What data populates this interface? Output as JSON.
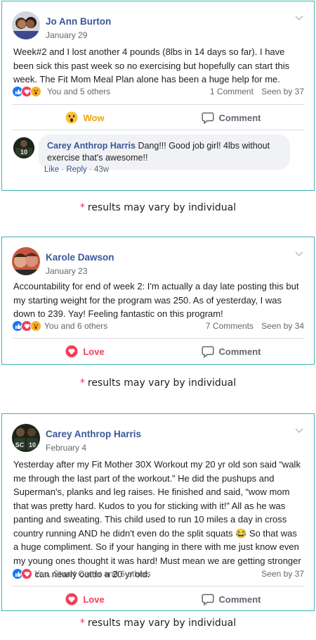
{
  "posts": [
    {
      "author": "Jo Ann Burton",
      "date": "January 29",
      "text": "Week#2 and I lost another 4 pounds (8lbs in 14 days so far). I have been sick this past week so no exercising but hopefully can start this week. The Fit Mom Meal Plan alone has been a huge help for me.",
      "reactions_label": "You and 5 others",
      "comments_label": "1 Comment",
      "seen_label": "Seen by 37",
      "reaction_action": "Wow",
      "comment_action": "Comment",
      "comment": {
        "author": "Carey Anthrop Harris",
        "text": "Dang!!! Good job girl! 4lbs without exercise that's awesome!!",
        "like": "Like",
        "reply": "Reply",
        "age": "43w"
      }
    },
    {
      "author": "Karole Dawson",
      "date": "January 23",
      "text": "Accountability for end of week 2: I'm actually a day late posting this but my starting weight for the program was 250. As of yesterday, I was down to 239. Yay! Feeling fantastic on this program!",
      "reactions_label": "You and 6 others",
      "comments_label": "7 Comments",
      "seen_label": "Seen by 34",
      "reaction_action": "Love",
      "comment_action": "Comment"
    },
    {
      "author": "Carey Anthrop Harris",
      "date": "February 4",
      "text": "Yesterday after my Fit Mother 30X Workout my 20 yr old son said “walk me through the last part of the workout.” He did the pushups and Superman's, planks and leg raises. He finished and said, “wow mom that was pretty hard. Kudos to you for sticking with it!” All as he was panting and sweating. This child used to run 10 miles a day in cross country running AND he didn't even do the split squats 😂 So that was a huge compliment. So if your hanging in there with me just know even my young ones thought it was hard! Must mean we are getting stronger if we can nearly outdo a 20 yr old.",
      "reactions_label": "You, Stuart Carter and 6 others",
      "seen_label": "Seen by 37",
      "reaction_action": "Love",
      "comment_action": "Comment"
    }
  ],
  "disclaimer": {
    "star": "*",
    "text": "results may vary by individual"
  },
  "colors": {
    "border": "#3bb5b0",
    "name_link": "#385898",
    "like_blue": "#1877f2",
    "love_red": "#f33e58",
    "wow_yellow": "#f7b125",
    "disclaimer_star": "#e8334a"
  },
  "icons": {
    "caret": "chevron-down-icon",
    "comment": "comment-bubble-icon",
    "love": "heart-icon",
    "wow": "wow-face-icon",
    "like": "thumbs-up-icon"
  }
}
